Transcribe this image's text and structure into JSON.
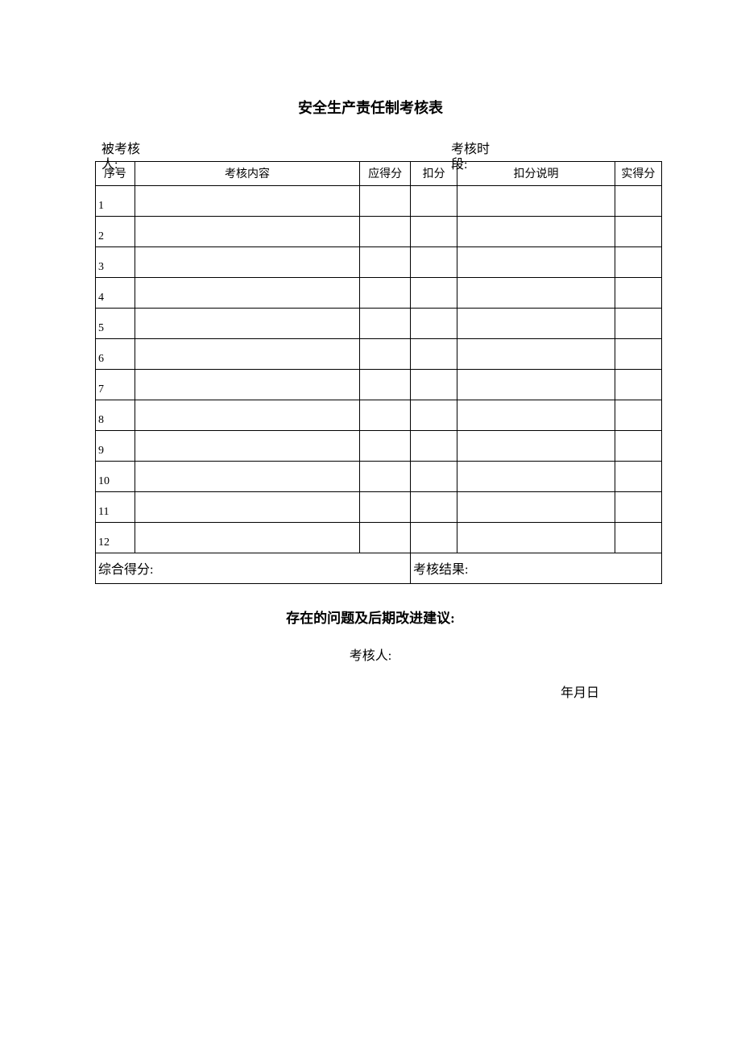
{
  "title": "安全生产责任制考核表",
  "meta": {
    "assessed_person_label_line1": "被考核",
    "assessed_person_label_line2": "人:",
    "period_label_line1": "考核时",
    "period_label_line2": "段:"
  },
  "headers": {
    "seq": "序号",
    "content": "考核内容",
    "expected": "应得分",
    "deduct": "扣分",
    "explain": "扣分说明",
    "actual": "实得分"
  },
  "rows": [
    {
      "seq": "1",
      "content": "",
      "expected": "",
      "deduct": "",
      "explain": "",
      "actual": ""
    },
    {
      "seq": "2",
      "content": "",
      "expected": "",
      "deduct": "",
      "explain": "",
      "actual": ""
    },
    {
      "seq": "3",
      "content": "",
      "expected": "",
      "deduct": "",
      "explain": "",
      "actual": ""
    },
    {
      "seq": "4",
      "content": "",
      "expected": "",
      "deduct": "",
      "explain": "",
      "actual": ""
    },
    {
      "seq": "5",
      "content": "",
      "expected": "",
      "deduct": "",
      "explain": "",
      "actual": ""
    },
    {
      "seq": "6",
      "content": "",
      "expected": "",
      "deduct": "",
      "explain": "",
      "actual": ""
    },
    {
      "seq": "7",
      "content": "",
      "expected": "",
      "deduct": "",
      "explain": "",
      "actual": ""
    },
    {
      "seq": "8",
      "content": "",
      "expected": "",
      "deduct": "",
      "explain": "",
      "actual": ""
    },
    {
      "seq": "9",
      "content": "",
      "expected": "",
      "deduct": "",
      "explain": "",
      "actual": ""
    },
    {
      "seq": "10",
      "content": "",
      "expected": "",
      "deduct": "",
      "explain": "",
      "actual": ""
    },
    {
      "seq": "11",
      "content": "",
      "expected": "",
      "deduct": "",
      "explain": "",
      "actual": ""
    },
    {
      "seq": "12",
      "content": "",
      "expected": "",
      "deduct": "",
      "explain": "",
      "actual": ""
    }
  ],
  "summary": {
    "total_label": "综合得分:",
    "result_label": "考核结果:"
  },
  "footer": {
    "suggestion_label": "存在的问题及后期改进建议:",
    "assessor_label": "考核人:",
    "date_label": "年月日"
  }
}
